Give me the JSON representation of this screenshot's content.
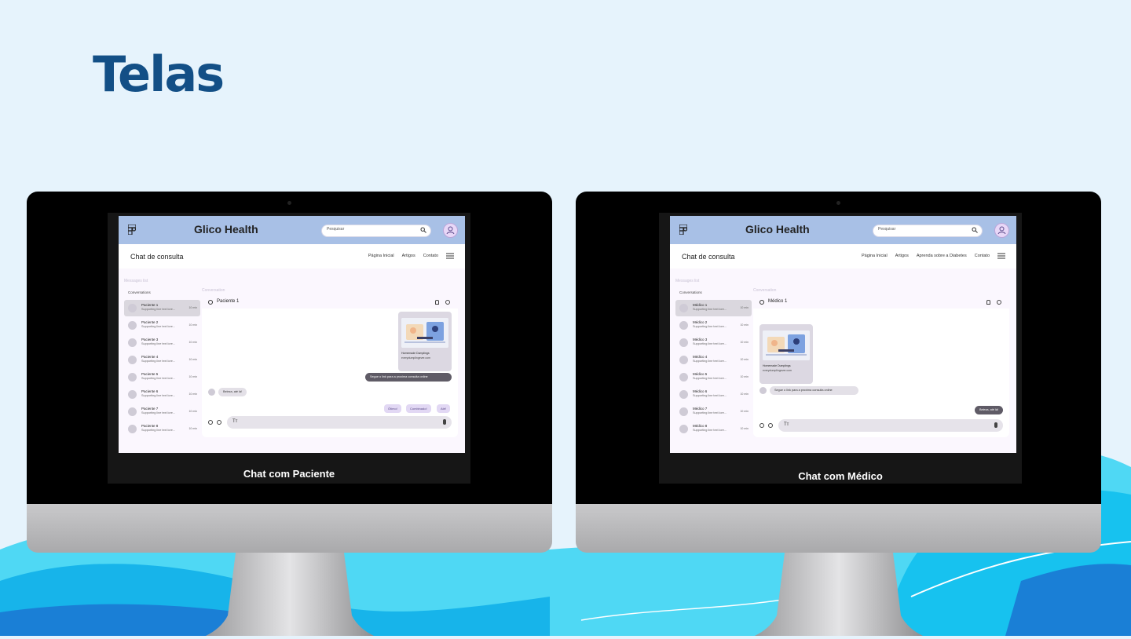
{
  "slide": {
    "title": "Telas"
  },
  "screens": [
    {
      "caption": "Chat com Paciente",
      "app": {
        "brand": "Glico Health",
        "search_placeholder": "Pesquisar",
        "page_title": "Chat de consulta",
        "nav": [
          "Página Inicial",
          "Artigos",
          "Contato"
        ],
        "messages_caption": "Messages list",
        "conversation_caption": "Conversation",
        "conversations_label": "Conversations",
        "list": [
          {
            "name": "Paciente 1",
            "sub": "Supporting line text lore...",
            "time": "10 min",
            "selected": true
          },
          {
            "name": "Paciente 2",
            "sub": "Supporting line text lore...",
            "time": "10 min"
          },
          {
            "name": "Paciente 3",
            "sub": "Supporting line text lore...",
            "time": "10 min"
          },
          {
            "name": "Paciente 4",
            "sub": "Supporting line text lore...",
            "time": "10 min"
          },
          {
            "name": "Paciente 5",
            "sub": "Supporting line text lore...",
            "time": "10 min"
          },
          {
            "name": "Paciente 6",
            "sub": "Supporting line text lore...",
            "time": "10 min"
          },
          {
            "name": "Paciente 7",
            "sub": "Supporting line text lore...",
            "time": "10 min"
          },
          {
            "name": "Paciente 8",
            "sub": "Supporting line text lore...",
            "time": "10 min"
          }
        ],
        "chat_name": "Paciente 1",
        "card_title": "Homemade Dumplings",
        "card_sub": "everydumplingever.com",
        "msg_link": "Segue o link para a proxima consulta online",
        "msg_reply": "Beleza, até lá!",
        "chips": [
          "Ótimo!",
          "Combinado!",
          "Até!"
        ],
        "composer_placeholder": "Tт"
      }
    },
    {
      "caption": "Chat com Médico",
      "app": {
        "brand": "Glico Health",
        "search_placeholder": "Pesquisar",
        "page_title": "Chat de consulta",
        "nav": [
          "Página Inicial",
          "Artigos",
          "Aprenda sobre a Diabetes",
          "Contato"
        ],
        "messages_caption": "Messages list",
        "conversation_caption": "Conversation",
        "conversations_label": "Conversations",
        "list": [
          {
            "name": "Médico 1",
            "sub": "Supporting line text lore...",
            "time": "10 min",
            "selected": true
          },
          {
            "name": "Médico 2",
            "sub": "Supporting line text lore...",
            "time": "10 min"
          },
          {
            "name": "Médico 3",
            "sub": "Supporting line text lore...",
            "time": "10 min"
          },
          {
            "name": "Médico 4",
            "sub": "Supporting line text lore...",
            "time": "10 min"
          },
          {
            "name": "Médico 5",
            "sub": "Supporting line text lore...",
            "time": "10 min"
          },
          {
            "name": "Médico 6",
            "sub": "Supporting line text lore...",
            "time": "10 min"
          },
          {
            "name": "Médico 7",
            "sub": "Supporting line text lore...",
            "time": "10 min"
          },
          {
            "name": "Médico 8",
            "sub": "Supporting line text lore...",
            "time": "10 min"
          }
        ],
        "chat_name": "Médico 1",
        "card_title": "Homemade Dumplings",
        "card_sub": "everydumplingever.com",
        "msg_link": "Segue o link para a proxima consulta online",
        "msg_reply": "Beleza, até lá!",
        "composer_placeholder": "Tт"
      }
    }
  ],
  "colors": {
    "title": "#134f86",
    "topbar": "#a8c0e6",
    "background": "#e6f3fc",
    "wave": "#1ec8f0"
  }
}
